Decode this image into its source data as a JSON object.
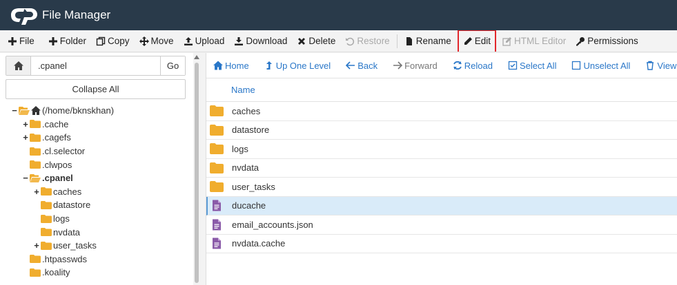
{
  "app": {
    "title": "File Manager"
  },
  "toolbar": {
    "file": "File",
    "folder": "Folder",
    "copy": "Copy",
    "move": "Move",
    "upload": "Upload",
    "download": "Download",
    "delete": "Delete",
    "restore": "Restore",
    "rename": "Rename",
    "edit": "Edit",
    "html_editor": "HTML Editor",
    "permissions": "Permissions"
  },
  "pathbar": {
    "value": ".cpanel",
    "go_label": "Go"
  },
  "collapse_label": "Collapse All",
  "tree": [
    {
      "toggle": "−",
      "label": "(/home/bknskhan)",
      "level": 0,
      "open": true,
      "home": true
    },
    {
      "toggle": "+",
      "label": ".cache",
      "level": 1
    },
    {
      "toggle": "+",
      "label": ".cagefs",
      "level": 1
    },
    {
      "toggle": "",
      "label": ".cl.selector",
      "level": 1
    },
    {
      "toggle": "",
      "label": ".clwpos",
      "level": 1
    },
    {
      "toggle": "−",
      "label": ".cpanel",
      "level": 1,
      "open": true,
      "bold": true
    },
    {
      "toggle": "+",
      "label": "caches",
      "level": 2
    },
    {
      "toggle": "",
      "label": "datastore",
      "level": 2
    },
    {
      "toggle": "",
      "label": "logs",
      "level": 2
    },
    {
      "toggle": "",
      "label": "nvdata",
      "level": 2
    },
    {
      "toggle": "+",
      "label": "user_tasks",
      "level": 2
    },
    {
      "toggle": "",
      "label": ".htpasswds",
      "level": 1
    },
    {
      "toggle": "",
      "label": ".koality",
      "level": 1
    }
  ],
  "nav": {
    "home": "Home",
    "up": "Up One Level",
    "back": "Back",
    "forward": "Forward",
    "reload": "Reload",
    "select_all": "Select All",
    "unselect_all": "Unselect All",
    "view_trash": "View Tra"
  },
  "columns": {
    "name": "Name"
  },
  "files": [
    {
      "name": "caches",
      "type": "folder"
    },
    {
      "name": "datastore",
      "type": "folder"
    },
    {
      "name": "logs",
      "type": "folder"
    },
    {
      "name": "nvdata",
      "type": "folder"
    },
    {
      "name": "user_tasks",
      "type": "folder"
    },
    {
      "name": "ducache",
      "type": "file",
      "selected": true
    },
    {
      "name": "email_accounts.json",
      "type": "file"
    },
    {
      "name": "nvdata.cache",
      "type": "file"
    }
  ],
  "colors": {
    "header_bg": "#293a4a",
    "link_blue": "#2a77c8",
    "folder_yellow": "#f0ad2e",
    "file_purple": "#8a5aa8",
    "selected_row": "#d9ebf9",
    "highlight_red": "#e3262b"
  },
  "icons": {
    "file": "plus-icon",
    "folder": "plus-icon",
    "copy": "copy-icon",
    "move": "move-arrows-icon",
    "upload": "upload-icon",
    "download": "download-icon",
    "delete": "x-icon",
    "restore": "undo-icon",
    "rename": "file-icon",
    "edit": "pencil-icon",
    "html_editor": "edit-square-icon",
    "permissions": "key-icon"
  }
}
